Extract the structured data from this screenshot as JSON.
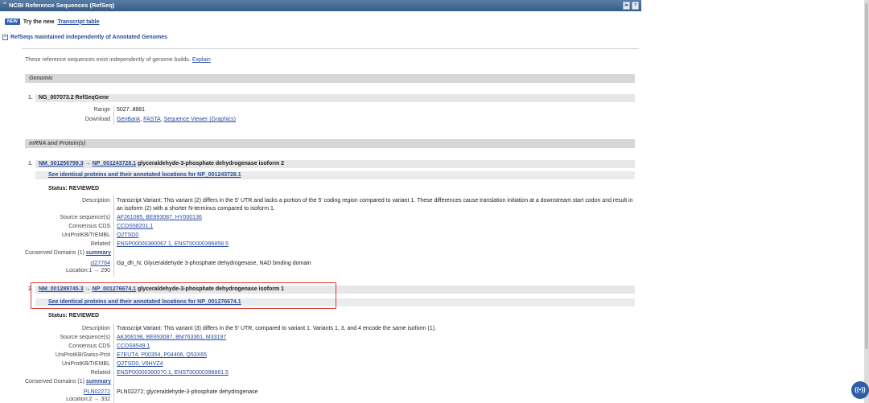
{
  "panel": {
    "title": "NCBI Reference Sequences (RefSeq)",
    "caret": "⌃",
    "buttons": [
      "≫",
      "?"
    ]
  },
  "new_banner": {
    "badge": "NEW",
    "text": "Try the new",
    "link": "Transcript table"
  },
  "section": {
    "toggle": "−",
    "title": "RefSeqs maintained independently of Annotated Genomes"
  },
  "intro": {
    "text": "These reference sequences exist independently of genome builds.",
    "link": "Explain"
  },
  "genomic": {
    "heading": "Genomic",
    "item": {
      "num": "1.",
      "title": "NG_007073.2 RefSeqGene",
      "range_label": "Range",
      "range_value": "5027..8881",
      "download_label": "Download",
      "download_links": [
        "GenBank",
        "FASTA",
        "Sequence Viewer (Graphics)"
      ]
    }
  },
  "mrna": {
    "heading": "mRNA and Protein(s)",
    "items": [
      {
        "num": "1.",
        "nm": "NM_001256799.3",
        "arrow": "→",
        "np": "NP_001243728.1",
        "desc": "glyceraldehyde-3-phosphate dehydrogenase isoform 2",
        "see_link": "See identical proteins and their annotated locations for NP_001243728.1",
        "status": "Status: REVIEWED",
        "description_label": "Description",
        "description": "Transcript Variant: This variant (2) differs in the 5' UTR and lacks a portion of the 5' coding region compared to variant 1. These differences cause translation initiation at a downstream start codon and result in",
        "description2": "an isoform (2) with a shorter N-terminus compared to isoform 1.",
        "source_label": "Source sequence(s)",
        "source": "AF261085, BE893087, HY000136",
        "ccds_label": "Consensus CDS",
        "ccds": "CCDS58201.1",
        "uniprot_label": "UniProtKB/TrEMBL",
        "uniprot": "Q2TSD0",
        "related_label": "Related",
        "related": "ENSP00000380067.1, ENST00000396858.5",
        "conserved_label": "Conserved Domains (1)",
        "conserved_link": "summary",
        "domain_id": "cl27764",
        "domain_desc": "Gp_dh_N; Glyceraldehyde 3-phosphate dehydrogenase, NAD binding domain",
        "domain_loc": "Location:1 → 290"
      },
      {
        "num": "2.",
        "nm": "NM_001289745.3",
        "arrow": "→",
        "np": "NP_001276674.1",
        "desc": "glyceraldehyde-3-phosphate dehydrogenase isoform 1",
        "see_link": "See identical proteins and their annotated locations for NP_001276674.1",
        "status": "Status: REVIEWED",
        "description_label": "Description",
        "description": "Transcript Variant: This variant (3) differs in the 5' UTR, compared to variant 1. Variants 1, 3, and 4 encode the same isoform (1).",
        "source_label": "Source sequence(s)",
        "source": "AK308198, BE893087, BM763361, M33197",
        "ccds_label": "Consensus CDS",
        "ccds": "CCDS8549.1",
        "swiss_label": "UniProtKB/Swiss-Prot",
        "swiss": "E7EUT4, P00354, P04406, Q53X65",
        "uniprot_label": "UniProtKB/TrEMBL",
        "uniprot": "Q2TSD0, V9HVZ4",
        "related_label": "Related",
        "related": "ENSP00000380070.1, ENST00000396861.5",
        "conserved_label": "Conserved Domains (1)",
        "conserved_link": "summary",
        "domain_id": "PLN02272",
        "domain_desc": "PLN02272; glyceraldehyde-3-phosphate dehydrogenase",
        "domain_loc": "Location:2 → 332"
      }
    ]
  },
  "fab": {
    "icon": "((•))"
  },
  "colors": {
    "highlight": "#e23b32",
    "link": "#2a4b9b",
    "header": "#345d86"
  }
}
